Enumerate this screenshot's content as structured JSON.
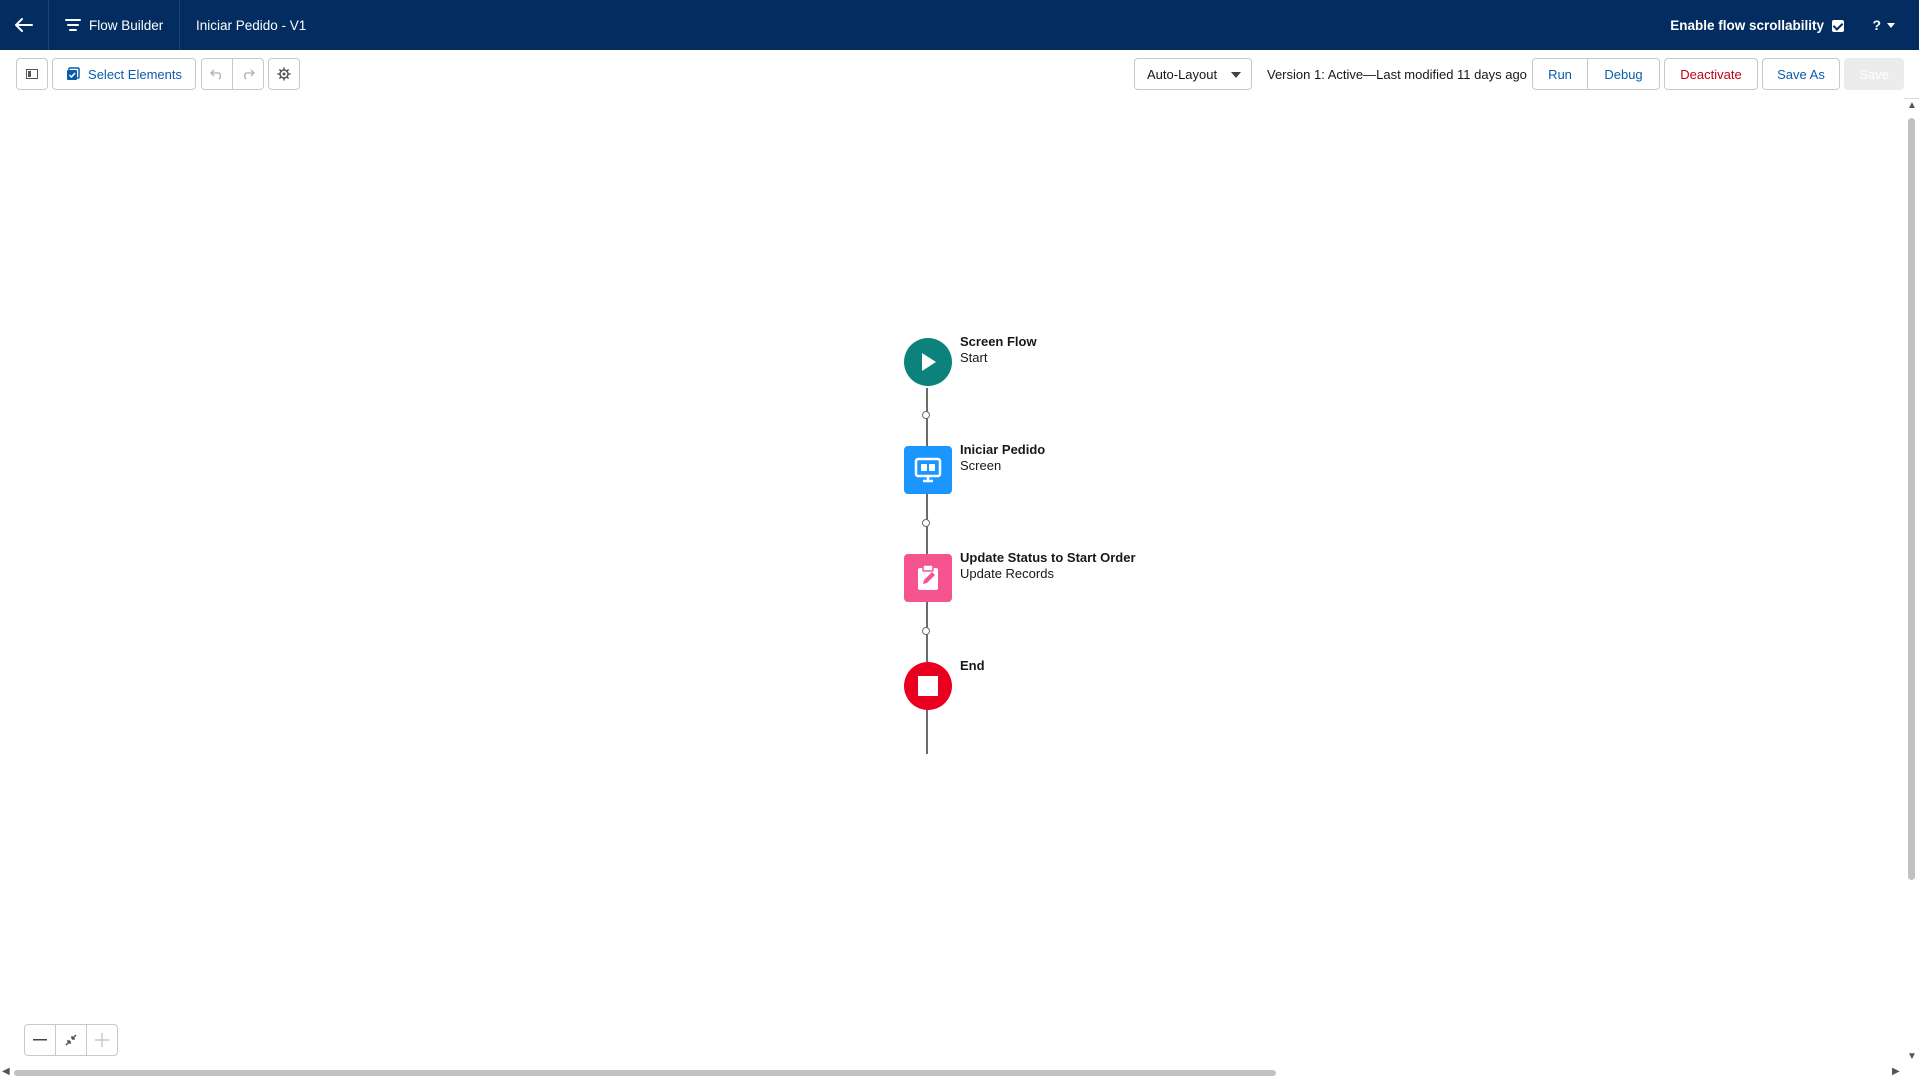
{
  "header": {
    "app_name": "Flow Builder",
    "flow_title": "Iniciar Pedido - V1",
    "scrollability_label": "Enable flow scrollability",
    "scrollability_checked": true,
    "help_label": "?"
  },
  "toolbar": {
    "select_elements_label": "Select Elements",
    "layout_value": "Auto-Layout",
    "version_text": "Version 1: Active—Last modified 11 days ago",
    "run_label": "Run",
    "debug_label": "Debug",
    "deactivate_label": "Deactivate",
    "save_as_label": "Save As",
    "save_label": "Save"
  },
  "flow": {
    "nodes": [
      {
        "title": "Screen Flow",
        "subtitle": "Start",
        "icon": "play-icon",
        "color": "#0b827c"
      },
      {
        "title": "Iniciar Pedido",
        "subtitle": "Screen",
        "icon": "screen-icon",
        "color": "#1b96ff"
      },
      {
        "title": "Update Status to Start Order",
        "subtitle": "Update Records",
        "icon": "update-records-icon",
        "color": "#f5548f"
      },
      {
        "title": "End",
        "subtitle": "",
        "icon": "stop-icon",
        "color": "#ea001e"
      }
    ]
  },
  "colors": {
    "header_bg": "#032d60",
    "link_blue": "#0b5cab",
    "destructive": "#ba0517"
  }
}
